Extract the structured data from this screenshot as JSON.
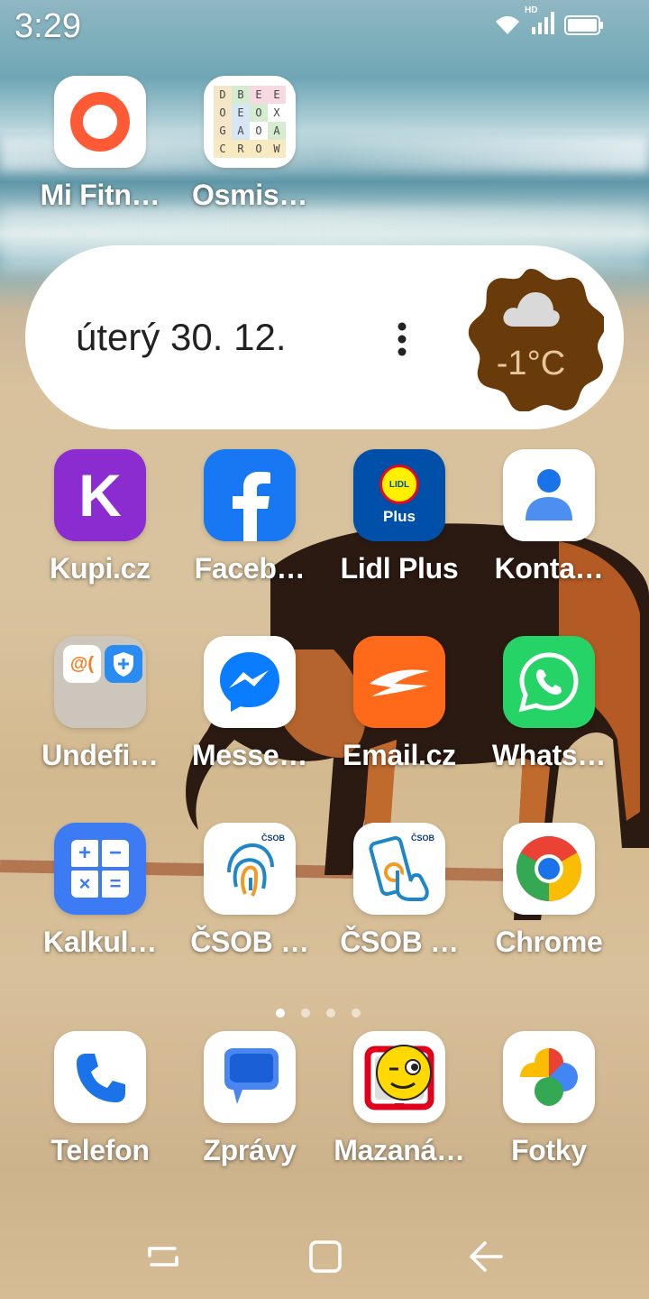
{
  "status_bar": {
    "time": "3:29",
    "network_label": "HD",
    "icons": [
      "wifi-icon",
      "cell-signal-icon",
      "battery-icon"
    ]
  },
  "widget": {
    "date": "úterý 30. 12.",
    "menu_icon": "more-vertical-icon",
    "weather_icon": "cloud-icon",
    "temperature": "-1°C"
  },
  "apps_top": [
    {
      "label": "Mi Fitn…",
      "icon": "mi-fitness-icon",
      "color": "#ff5a36"
    },
    {
      "label": "Osmis…",
      "icon": "word-search-icon",
      "color": "#ffffff"
    }
  ],
  "wordsearch_letters": [
    "D",
    "B",
    "E",
    "E",
    "O",
    "E",
    "O",
    "X",
    "G",
    "A",
    "O",
    "A",
    "C",
    "R",
    "O",
    "W"
  ],
  "lidl": {
    "logo": "LIDL",
    "sub": "Plus"
  },
  "grid": [
    [
      {
        "label": "Kupi.cz",
        "icon": "kupi-icon",
        "letter": "K"
      },
      {
        "label": "Faceb…",
        "icon": "facebook-icon"
      },
      {
        "label": "Lidl Plus",
        "icon": "lidl-plus-icon"
      },
      {
        "label": "Konta…",
        "icon": "contacts-icon"
      }
    ],
    [
      {
        "label": "Undefi…",
        "icon": "folder-icon"
      },
      {
        "label": "Messe…",
        "icon": "messenger-icon"
      },
      {
        "label": "Email.cz",
        "icon": "email-cz-icon"
      },
      {
        "label": "Whats…",
        "icon": "whatsapp-icon"
      }
    ],
    [
      {
        "label": "Kalkul…",
        "icon": "calculator-icon"
      },
      {
        "label": "ČSOB …",
        "icon": "csob-fingerprint-icon"
      },
      {
        "label": "ČSOB …",
        "icon": "csob-phone-icon"
      },
      {
        "label": "Chrome",
        "icon": "chrome-icon"
      }
    ]
  ],
  "dock": [
    {
      "label": "Telefon",
      "icon": "phone-icon"
    },
    {
      "label": "Zprávy",
      "icon": "messages-icon"
    },
    {
      "label": "Mazaná…",
      "icon": "mazana-icon"
    },
    {
      "label": "Fotky",
      "icon": "photos-icon"
    }
  ],
  "csob_badge": "ČSOB",
  "pages": {
    "count": 4,
    "active": 1
  },
  "nav": [
    "recents-icon",
    "home-icon",
    "back-icon"
  ]
}
